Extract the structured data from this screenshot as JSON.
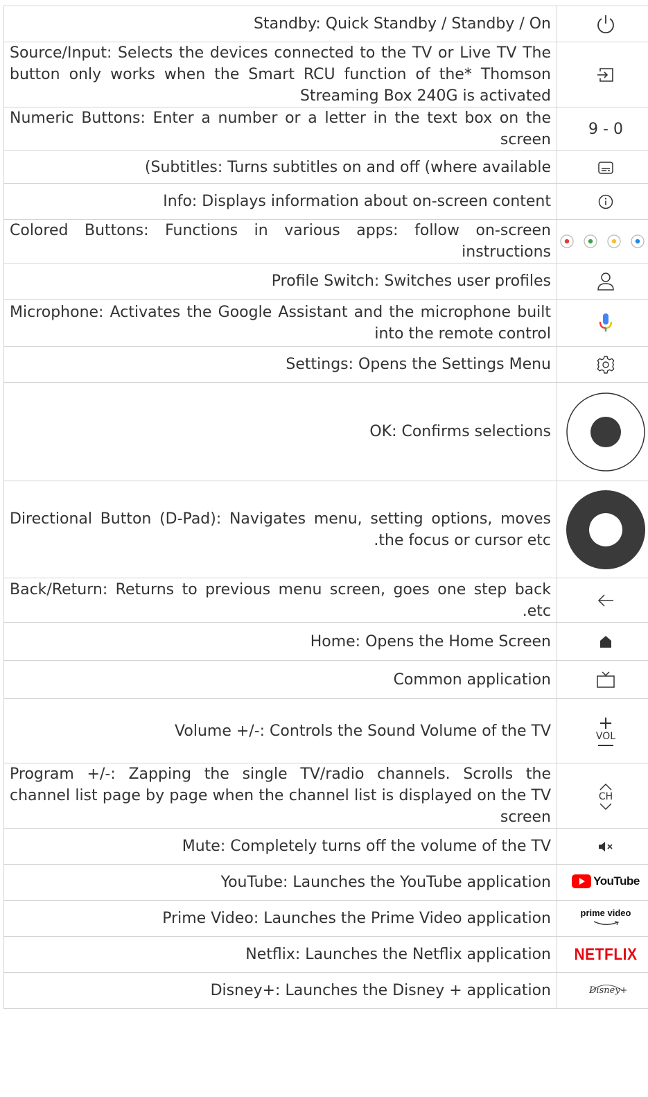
{
  "rows": [
    {
      "desc": "Standby: Quick Standby / Standby / On",
      "icon": "power-icon"
    },
    {
      "desc": "Source/Input: Selects the devices connected to the TV or Live TV The button only works when the Smart RCU function of the* Thomson Streaming Box 240G is activated",
      "icon": "source-input-icon"
    },
    {
      "desc": "Numeric Buttons: Enter a number or a letter in the text box on the screen",
      "icon_text": "9 - 0"
    },
    {
      "desc": "(Subtitles: Turns subtitles on and off (where available",
      "icon": "subtitles-icon"
    },
    {
      "desc": "Info: Displays information about on-screen content",
      "icon": "info-icon"
    },
    {
      "desc": "Colored Buttons: Functions in various apps: follow on-screen instructions",
      "icon": "colored-buttons-icon",
      "colors": [
        "#e53935",
        "#43a047",
        "#fbc02d",
        "#1e88e5"
      ]
    },
    {
      "desc": "Profile Switch: Switches user profiles",
      "icon": "profile-icon"
    },
    {
      "desc": "Microphone: Activates the Google Assistant and the microphone built into the remote control",
      "icon": "microphone-icon"
    },
    {
      "desc": "Settings: Opens the Settings Menu",
      "icon": "settings-gear-icon"
    },
    {
      "desc": "OK: Confirms selections",
      "icon": "ok-button-icon"
    },
    {
      "desc": "Directional Button (D-Pad): Navigates menu, setting options, moves the focus or cursor etc.",
      "desc_display": "Directional Button (D-Pad): Navigates menu, setting options, moves .the focus or cursor etc",
      "icon": "dpad-icon"
    },
    {
      "desc": "Back/Return: Returns to previous menu screen, goes one step back .etc",
      "icon": "back-arrow-icon"
    },
    {
      "desc": "Home: Opens the Home Screen",
      "icon": "home-icon"
    },
    {
      "desc": "Common application",
      "icon": "tv-icon"
    },
    {
      "desc": "Volume +/-: Controls the Sound Volume of the TV",
      "icon": "volume-icon",
      "icon_label": "VOL"
    },
    {
      "desc": "Program +/-: Zapping the single TV/radio channels. Scrolls the channel list page by page when the channel list is displayed on the TV screen",
      "icon": "channel-icon",
      "icon_label": "CH"
    },
    {
      "desc": "Mute: Completely turns off the volume of the TV",
      "icon": "mute-icon"
    },
    {
      "desc": "YouTube: Launches the YouTube application",
      "icon": "youtube-logo",
      "logo_text": "YouTube"
    },
    {
      "desc": "Prime Video: Launches the Prime Video application",
      "icon": "prime-video-logo",
      "logo_text": "prime video"
    },
    {
      "desc": "Netflix: Launches the Netflix application",
      "icon": "netflix-logo",
      "logo_text": "NETFLIX"
    },
    {
      "desc": "Disney+: Launches the Disney + application",
      "icon": "disney-plus-logo",
      "logo_text": "Disney+"
    }
  ]
}
